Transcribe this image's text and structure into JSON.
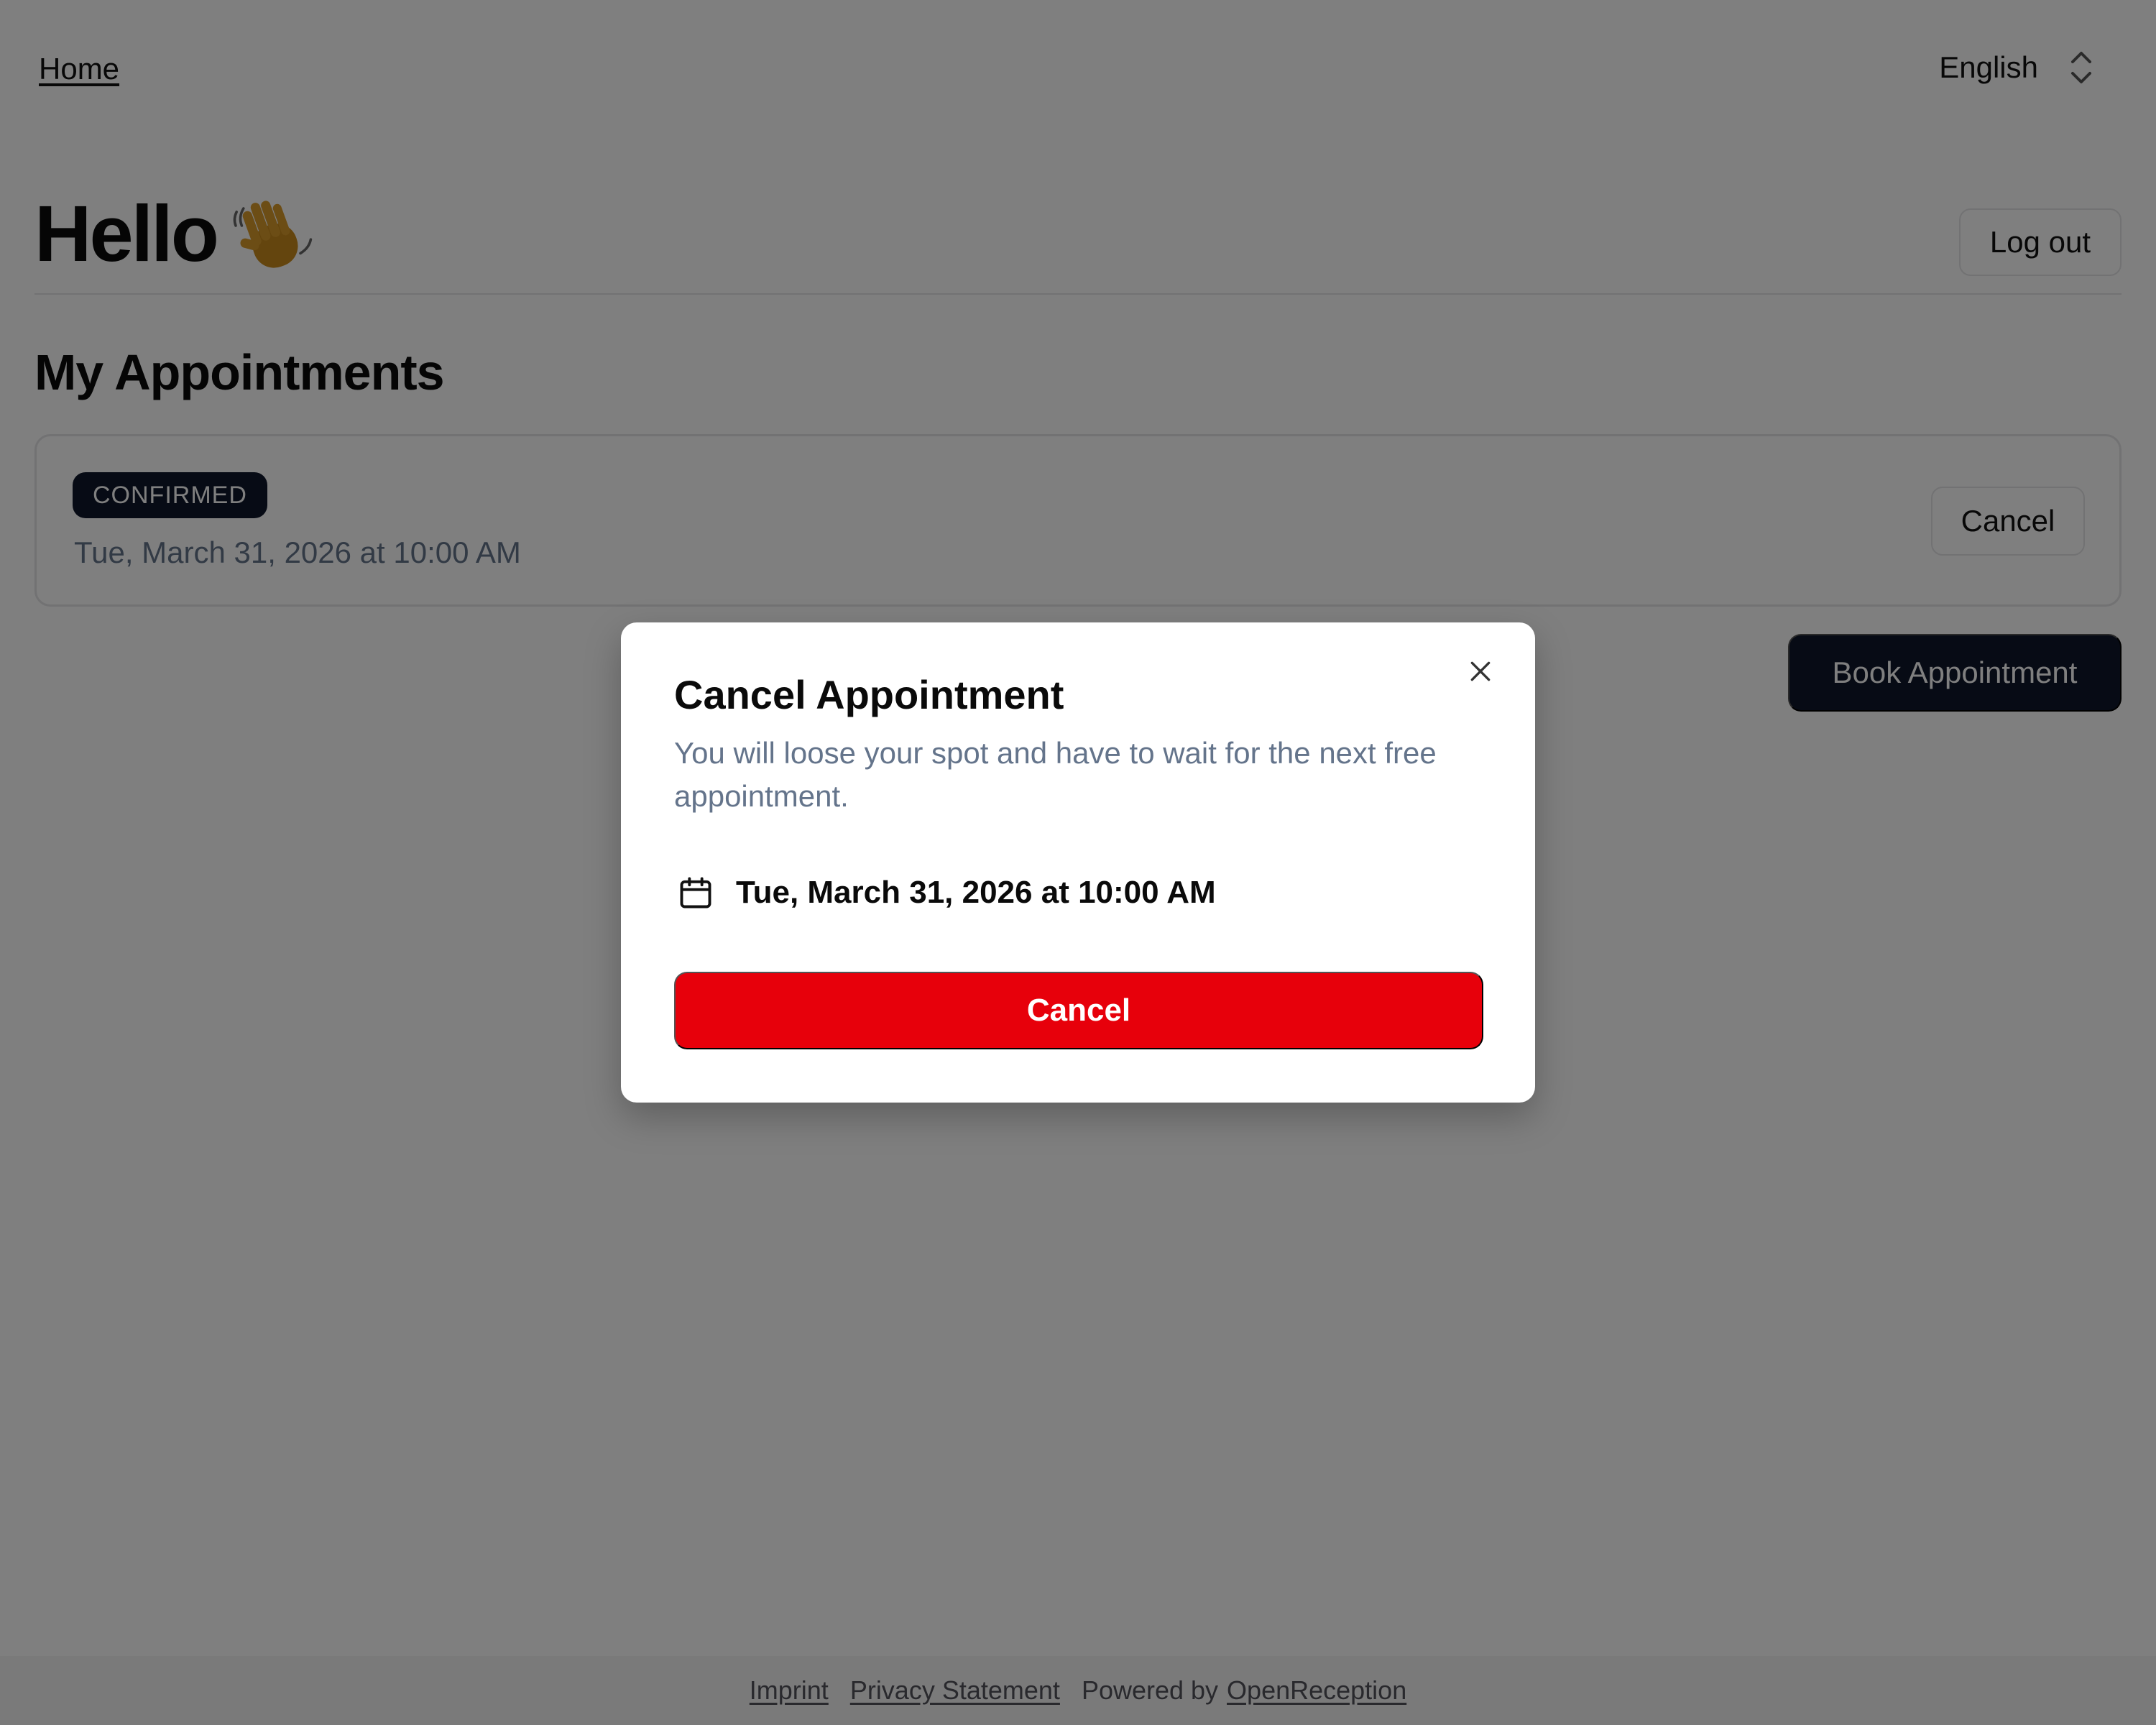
{
  "nav": {
    "home_label": "Home",
    "language": "English"
  },
  "header": {
    "greeting": "Hello",
    "logout_label": "Log out"
  },
  "appointments": {
    "title": "My Appointments",
    "items": [
      {
        "status": "CONFIRMED",
        "date": "Tue, March 31, 2026 at 10:00 AM",
        "cancel_label": "Cancel"
      }
    ],
    "book_label": "Book Appointment"
  },
  "footer": {
    "imprint": "Imprint",
    "privacy": "Privacy Statement",
    "powered_prefix": "Powered by",
    "powered_link": "OpenReception"
  },
  "modal": {
    "title": "Cancel Appointment",
    "description": "You will loose your spot and have to wait for the next free appointment.",
    "date": "Tue, March 31, 2026 at 10:00 AM",
    "confirm_label": "Cancel"
  },
  "colors": {
    "primary_dark": "#0f172a",
    "danger": "#e7000b",
    "muted_text": "#64748b"
  }
}
